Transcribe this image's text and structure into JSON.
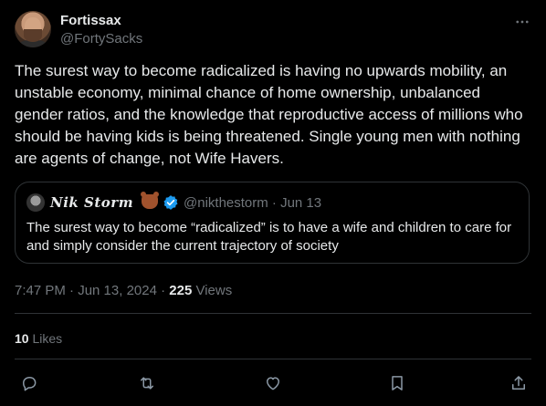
{
  "author": {
    "display_name": "Fortissax",
    "handle": "@FortySacks"
  },
  "tweet_text": "The surest way to become radicalized is having no upwards mobility, an unstable economy, minimal chance of home ownership, unbalanced gender ratios, and the knowledge that reproductive access of millions who should be having kids is being threatened. Single young men with nothing are agents of change, not Wife Havers.",
  "quoted": {
    "display_name": "𝑵𝒊𝒌 𝑺𝒕𝒐𝒓𝒎",
    "handle_date": "@nikthestorm · Jun 13",
    "text": "The surest way to become “radicalized” is to have a wife and children to care for and simply consider the current trajectory of society"
  },
  "meta": {
    "timestamp": "7:47 PM · Jun 13, 2024 · ",
    "views_count": "225",
    "views_label": " Views"
  },
  "likes": {
    "count": "10",
    "label": " Likes"
  },
  "icons": {
    "more": "more-horizontal-icon",
    "reply": "reply-icon",
    "retweet": "retweet-icon",
    "like": "heart-icon",
    "bookmark": "bookmark-icon",
    "share": "share-icon",
    "verified": "verified-badge-icon"
  },
  "colors": {
    "background": "#000000",
    "text": "#e7e9ea",
    "muted": "#71767b",
    "border": "#2f3336",
    "verified": "#1d9bf0"
  }
}
